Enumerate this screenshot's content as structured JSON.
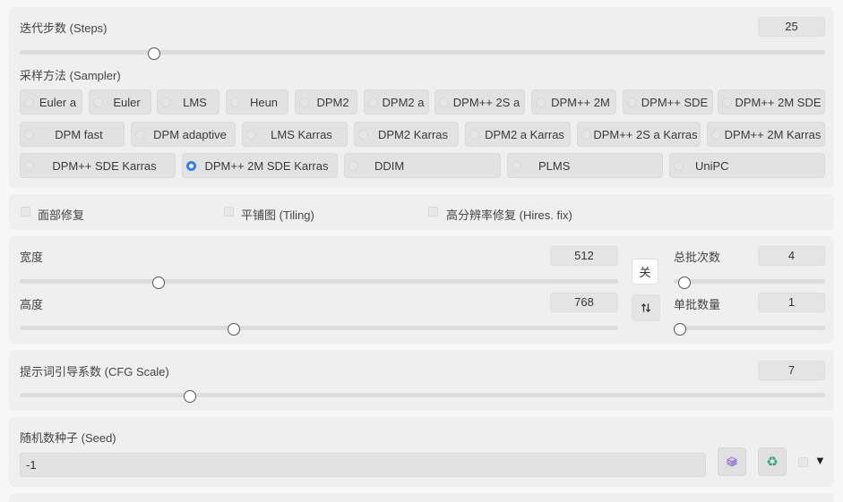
{
  "steps": {
    "label": "迭代步数 (Steps)",
    "value": "25"
  },
  "sampler": {
    "label": "采样方法 (Sampler)",
    "options": [
      "Euler a",
      "Euler",
      "LMS",
      "Heun",
      "DPM2",
      "DPM2 a",
      "DPM++ 2S a",
      "DPM++ 2M",
      "DPM++ SDE",
      "DPM++ 2M SDE",
      "DPM fast",
      "DPM adaptive",
      "LMS Karras",
      "DPM2 Karras",
      "DPM2 a Karras",
      "DPM++ 2S a Karras",
      "DPM++ 2M Karras",
      "DPM++ SDE Karras",
      "DPM++ 2M SDE Karras",
      "DDIM",
      "PLMS",
      "UniPC"
    ],
    "selected": "DPM++ 2M SDE Karras"
  },
  "options": {
    "face_restore": "面部修复",
    "tiling": "平铺图 (Tiling)",
    "hires_fix": "高分辨率修复 (Hires. fix)"
  },
  "dims": {
    "width_label": "宽度",
    "width_value": "512",
    "height_label": "高度",
    "height_value": "768",
    "lock_label": "关",
    "swap_icon": "swap-vertical-icon"
  },
  "batch": {
    "count_label": "总批次数",
    "count_value": "4",
    "size_label": "单批数量",
    "size_value": "1"
  },
  "cfg": {
    "label": "提示词引导系数 (CFG Scale)",
    "value": "7"
  },
  "seed": {
    "label": "随机数种子 (Seed)",
    "value": "-1",
    "dice_icon": "dice-icon",
    "recycle_icon": "recycle-icon",
    "expand_icon": "triangle-down-icon"
  },
  "colors": {
    "accent": "#2f80ed",
    "recycle": "#2aa876",
    "panel": "#efefef",
    "page": "#f7f7f7"
  }
}
